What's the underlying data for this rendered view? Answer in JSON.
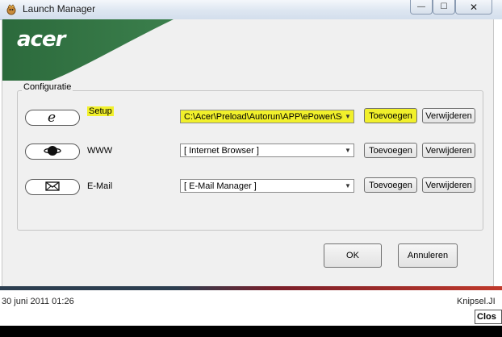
{
  "window": {
    "title": "Launch Manager",
    "controls": {
      "minimize": "—",
      "maximize": "☐",
      "close": "✕"
    }
  },
  "banner": {
    "logo_text": "acer"
  },
  "group": {
    "label": "Configuratie",
    "rows": [
      {
        "icon": "ie-icon",
        "label": "Setup",
        "value": "C:\\Acer\\Preload\\Autorun\\APP\\ePower\\Se",
        "add": "Toevoegen",
        "remove": "Verwijderen",
        "highlighted": true
      },
      {
        "icon": "globe-icon",
        "label": "WWW",
        "value": "[ Internet Browser ]",
        "add": "Toevoegen",
        "remove": "Verwijderen",
        "highlighted": false
      },
      {
        "icon": "mail-icon",
        "label": "E-Mail",
        "value": "[ E-Mail Manager ]",
        "add": "Toevoegen",
        "remove": "Verwijderen",
        "highlighted": false
      }
    ]
  },
  "footer_buttons": {
    "ok": "OK",
    "cancel": "Annuleren"
  },
  "bottom": {
    "timestamp": "30 juni 2011 01:26",
    "snip": "Knipsel.JI",
    "close": "Clos"
  },
  "colors": {
    "highlight": "#f1f02b",
    "acer_green": "#2f6b3e"
  }
}
